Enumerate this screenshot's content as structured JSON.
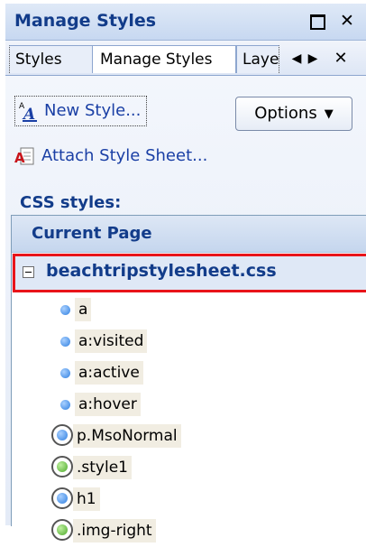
{
  "pane": {
    "title": "Manage Styles",
    "restore_glyph": "□",
    "close_glyph": "✕",
    "icons": {
      "restore": "restore-icon",
      "close": "close-icon"
    }
  },
  "tabs": {
    "items": [
      {
        "label": "Styles",
        "active": false
      },
      {
        "label": "Manage Styles",
        "active": true
      },
      {
        "label": "Layers",
        "active": false
      }
    ],
    "prev_glyph": "◀",
    "next_glyph": "▶",
    "close_glyph": "✕"
  },
  "toolbar": {
    "new_style_label": "New Style...",
    "options_label": "Options",
    "options_arrow": "▼",
    "attach_label": "Attach Style Sheet..."
  },
  "css_styles": {
    "section_label": "CSS styles:",
    "group_label": "Current Page",
    "file": {
      "name": "beachtripstylesheet.css",
      "expanded": true,
      "highlighted": true
    },
    "styles": [
      {
        "name": "a",
        "marker": "small-blue-dot"
      },
      {
        "name": "a:visited",
        "marker": "small-blue-dot"
      },
      {
        "name": "a:active",
        "marker": "small-blue-dot"
      },
      {
        "name": "a:hover",
        "marker": "small-blue-dot"
      },
      {
        "name": "p.MsoNormal",
        "marker": "ringed-blue-dot"
      },
      {
        "name": ".style1",
        "marker": "ringed-green-dot"
      },
      {
        "name": "h1",
        "marker": "ringed-blue-dot"
      },
      {
        "name": ".img-right",
        "marker": "ringed-green-dot"
      }
    ]
  },
  "colors": {
    "header_text": "#123c8a",
    "link_text": "#1a3fa5",
    "highlight_border": "#e8141a",
    "blue_dot": "#2f7fe0",
    "green_dot": "#4caa2a"
  }
}
